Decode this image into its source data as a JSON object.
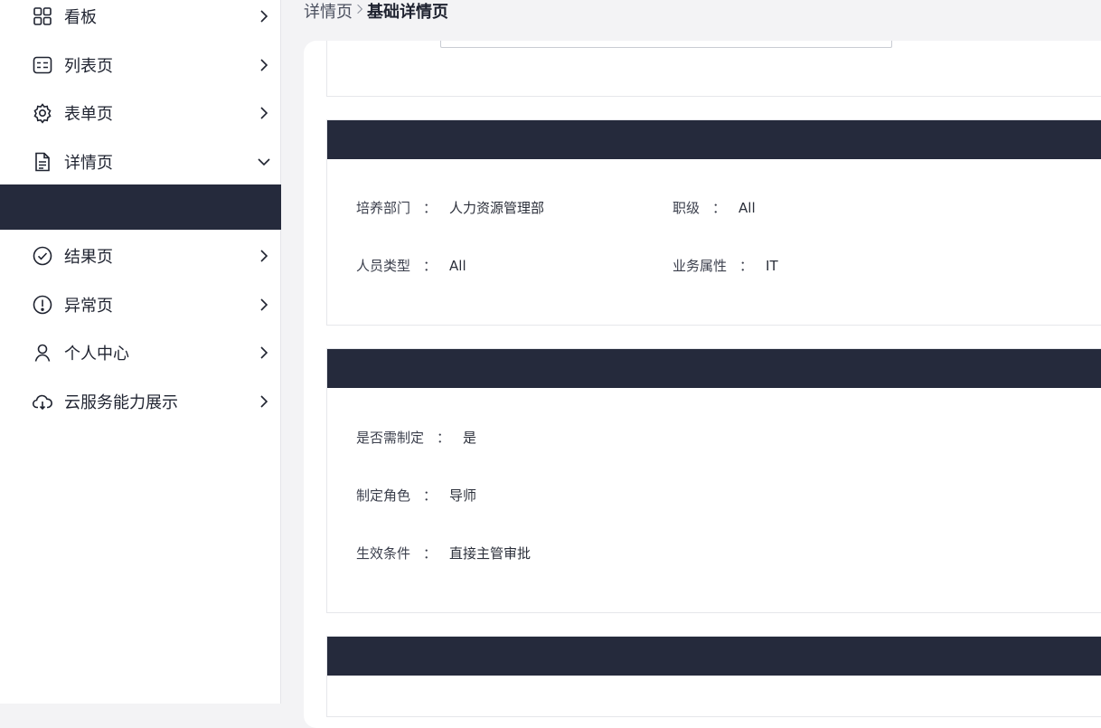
{
  "sidebar": {
    "items": [
      {
        "label": "看板",
        "icon": "dashboard-grid-icon"
      },
      {
        "label": "列表页",
        "icon": "list-icon"
      },
      {
        "label": "表单页",
        "icon": "gear-icon"
      },
      {
        "label": "详情页",
        "icon": "document-icon"
      },
      {
        "label": "结果页",
        "icon": "check-circle-icon"
      },
      {
        "label": "异常页",
        "icon": "exclamation-circle-icon"
      },
      {
        "label": "个人中心",
        "icon": "user-icon"
      },
      {
        "label": "云服务能力展示",
        "icon": "cloud-icon"
      }
    ],
    "active_bg": "#252a3c"
  },
  "breadcrumb": {
    "parent": "详情页",
    "current": "基础详情页"
  },
  "section1": {
    "fields": [
      {
        "key": "培养部门",
        "value": "人力资源管理部"
      },
      {
        "key": "职级",
        "value": "All"
      },
      {
        "key": "人员类型",
        "value": "All"
      },
      {
        "key": "业务属性",
        "value": "IT"
      }
    ]
  },
  "section2": {
    "fields": [
      {
        "key": "是否需制定",
        "value": "是"
      },
      {
        "key": "制定角色",
        "value": "导师"
      },
      {
        "key": "生效条件",
        "value": "直接主管审批"
      }
    ]
  },
  "colon": "：",
  "colors": {
    "header_bar": "#252a3c",
    "page_bg": "#f3f3f5"
  }
}
